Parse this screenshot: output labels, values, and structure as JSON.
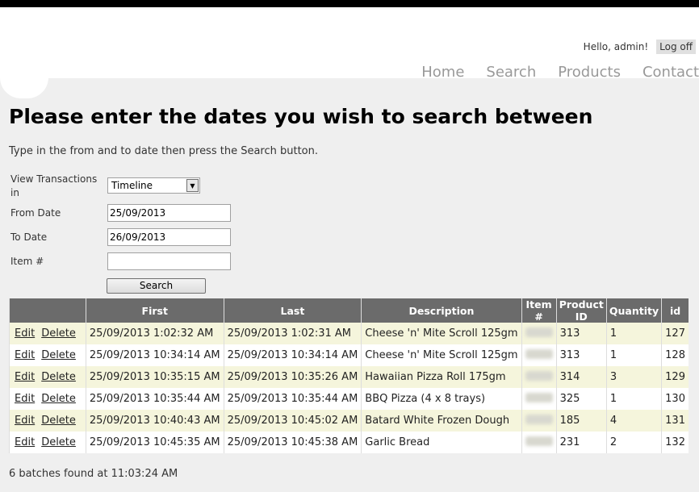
{
  "header": {
    "hello": "Hello, admin!",
    "logoff": "Log off"
  },
  "nav": [
    "Home",
    "Search",
    "Products",
    "Contact"
  ],
  "page": {
    "title": "Please enter the dates you wish to search between",
    "intro": "Type in the from and to date then press the Search button."
  },
  "form": {
    "view_label_1": "View Transactions",
    "view_label_2": "in",
    "view_value": "Timeline",
    "from_label": "From Date",
    "from_value": "25/09/2013",
    "to_label": "To Date",
    "to_value": "26/09/2013",
    "item_label": "Item #",
    "item_value": "",
    "search_label": "Search"
  },
  "table": {
    "headers": [
      "",
      "First",
      "Last",
      "Description",
      "Item #",
      "Product ID",
      "Quantity",
      "id"
    ],
    "edit_label": "Edit",
    "delete_label": "Delete",
    "rows": [
      {
        "first": "25/09/2013 1:02:32 AM",
        "last": "25/09/2013 1:02:31 AM",
        "description": "Cheese 'n' Mite Scroll 125gm",
        "product_id": "313",
        "quantity": "1",
        "id": "127"
      },
      {
        "first": "25/09/2013 10:34:14 AM",
        "last": "25/09/2013 10:34:14 AM",
        "description": "Cheese 'n' Mite Scroll 125gm",
        "product_id": "313",
        "quantity": "1",
        "id": "128"
      },
      {
        "first": "25/09/2013 10:35:15 AM",
        "last": "25/09/2013 10:35:26 AM",
        "description": "Hawaiian Pizza Roll 175gm",
        "product_id": "314",
        "quantity": "3",
        "id": "129"
      },
      {
        "first": "25/09/2013 10:35:44 AM",
        "last": "25/09/2013 10:35:44 AM",
        "description": "BBQ Pizza (4 x 8 trays)",
        "product_id": "325",
        "quantity": "1",
        "id": "130"
      },
      {
        "first": "25/09/2013 10:40:43 AM",
        "last": "25/09/2013 10:45:02 AM",
        "description": "Batard White Frozen Dough",
        "product_id": "185",
        "quantity": "4",
        "id": "131"
      },
      {
        "first": "25/09/2013 10:45:35 AM",
        "last": "25/09/2013 10:45:38 AM",
        "description": "Garlic Bread",
        "product_id": "231",
        "quantity": "2",
        "id": "132"
      }
    ]
  },
  "footer": {
    "status": "6 batches found at 11:03:24 AM"
  }
}
